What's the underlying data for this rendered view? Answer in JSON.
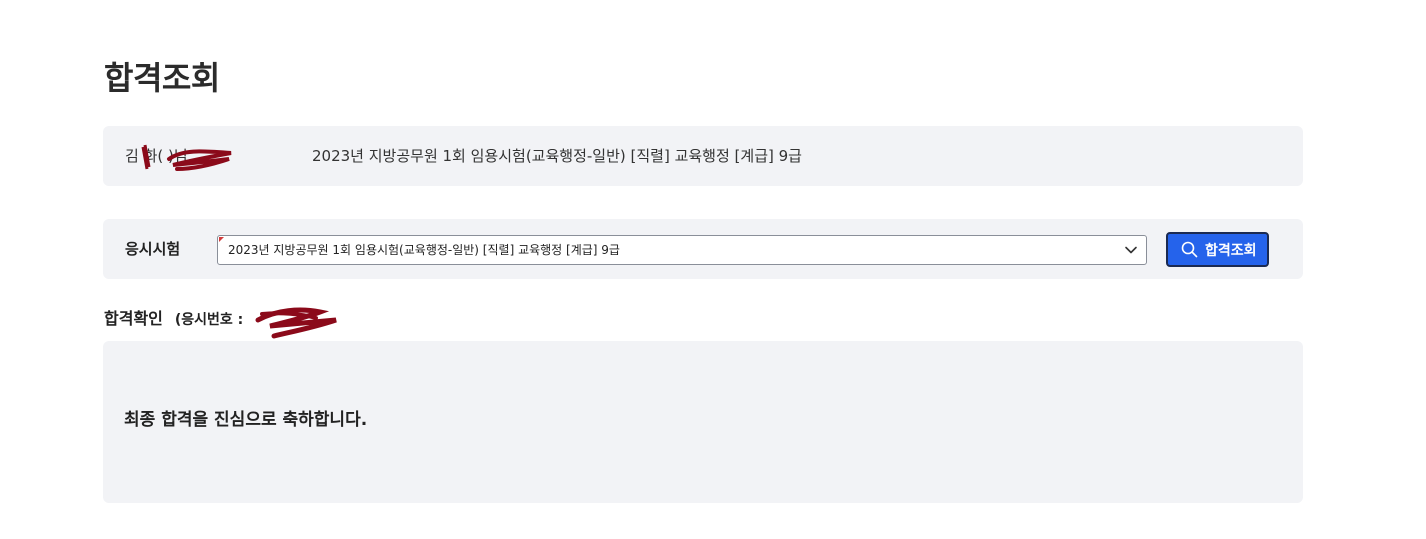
{
  "page": {
    "title": "합격조회"
  },
  "applicant": {
    "name_display": "김 화(           )님.",
    "exam_description": "2023년 지방공무원 1회 임용시험(교육행정-일반) [직렬] 교육행정 [계급] 9급"
  },
  "search": {
    "label": "응시시험",
    "selected_exam": "2023년 지방공무원 1회 임용시험(교육행정-일반) [직렬] 교육행정 [계급] 9급",
    "button_label": "합격조회"
  },
  "result": {
    "heading": "합격확인",
    "exam_number_label": "(응시번호 :",
    "message": "최종 합격을 진심으로 축하합니다."
  },
  "colors": {
    "panel_background": "#f2f3f6",
    "button_primary": "#2563eb",
    "button_border": "#1b2a52",
    "redaction_ink": "#8b0a1a"
  },
  "icons": {
    "select_toggle": "chevron-down-icon",
    "search": "search-icon"
  }
}
